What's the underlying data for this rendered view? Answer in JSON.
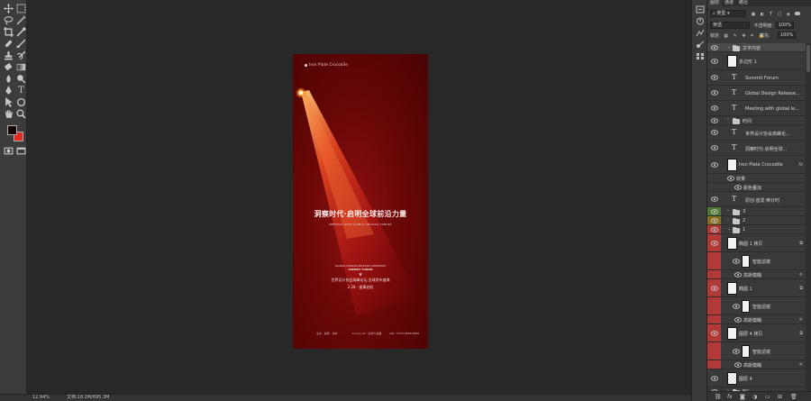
{
  "toolbar": {
    "tools": [
      "move",
      "marquee",
      "lasso",
      "magic-wand",
      "crop",
      "eyedropper",
      "healing",
      "brush",
      "stamp",
      "history-brush",
      "eraser",
      "gradient",
      "blur",
      "dodge",
      "pen",
      "type",
      "path-select",
      "shape",
      "hand",
      "zoom"
    ],
    "foreground_color": "#180606",
    "background_color": "#e42a1e"
  },
  "document": {
    "brand": "Iron Plate Crocodile",
    "headline": "洞察时代·启明全球前沿力量",
    "subtitle": "MEETING WITH GLOBAL LEADING FORCES",
    "event_line1": "GLOBAL DESIGN RELEASE CEREMONY",
    "event_line2": "SUMMIT FORUM",
    "event_cn": "世界设计协会高峰论坛·全球发布盛典",
    "date": "2.28 · 盛事启航",
    "footer_left": "主办 · 指导 · 协办",
    "footer_mid": "Forum A5 / 全球大会堂",
    "footer_right": "+86 / 0755-8888 8888"
  },
  "status": {
    "zoom": "12.94%",
    "doc_size": "文档:18.2M/695.3M"
  },
  "layers_panel": {
    "tabs": [
      "图层",
      "通道",
      "路径"
    ],
    "filter": {
      "label": "类型"
    },
    "blend_mode": "穿透",
    "opacity_label": "不透明度:",
    "opacity_value": "100%",
    "lock_label": "锁定:",
    "fill_label": "填充:",
    "fill_value": "100%",
    "layers": [
      {
        "name": "文字内容",
        "kind": "group",
        "open": true
      },
      {
        "name": "多边形 1",
        "kind": "shape"
      },
      {
        "name": "Summit Forum",
        "kind": "text"
      },
      {
        "name": "Global Design Release...",
        "kind": "text"
      },
      {
        "name": "Meeting with global le...",
        "kind": "text"
      },
      {
        "name": "时间",
        "kind": "group",
        "open": false
      },
      {
        "name": "世界设计协会高峰论...",
        "kind": "text"
      },
      {
        "name": "洞察时代·启明全球...",
        "kind": "text"
      },
      {
        "name": "Iron Plate Crocodile",
        "kind": "smart",
        "fx": "fx"
      },
      {
        "name": "效果",
        "kind": "effect"
      },
      {
        "name": "颜色叠加",
        "kind": "effect-item"
      },
      {
        "name": "原创·首发·倒计时",
        "kind": "text"
      },
      {
        "name": "3",
        "kind": "group",
        "color": "#4f7a34"
      },
      {
        "name": "2",
        "kind": "group",
        "color": "#8a6d1e"
      },
      {
        "name": "1",
        "kind": "group",
        "color": "#b23a36",
        "open": true
      },
      {
        "name": "椭圆 1 拷贝",
        "kind": "smart"
      },
      {
        "name": "智能滤镜",
        "kind": "filter"
      },
      {
        "name": "高斯模糊",
        "kind": "filter-item"
      },
      {
        "name": "椭圆 1",
        "kind": "smart"
      },
      {
        "name": "智能滤镜",
        "kind": "filter"
      },
      {
        "name": "高斯模糊",
        "kind": "filter-item"
      },
      {
        "name": "图层 4 拷贝",
        "kind": "smart"
      },
      {
        "name": "智能滤镜",
        "kind": "filter"
      },
      {
        "name": "高斯模糊",
        "kind": "filter-item"
      },
      {
        "name": "图层 4",
        "kind": "pixel"
      },
      {
        "name": "BG",
        "kind": "group"
      }
    ]
  },
  "colors": {
    "red_group": "#b23a36",
    "panel_bg": "#393939",
    "canvas_bg": "#282828"
  }
}
